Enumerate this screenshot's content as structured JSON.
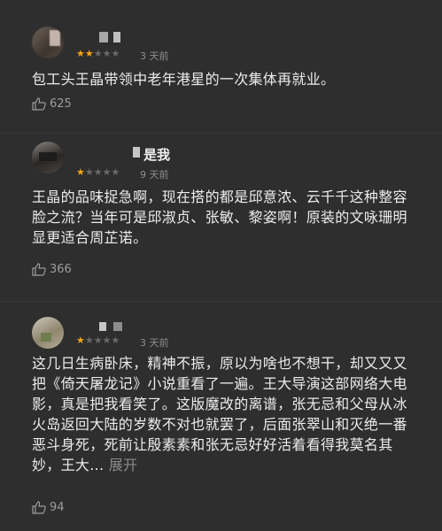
{
  "reviews": [
    {
      "name": "",
      "rating": 2,
      "stars": "★★★★★",
      "time": "3 天前",
      "text": "包工头王晶带领中老年港星的一次集体再就业。",
      "likes": "625",
      "avatar_icon": "user-avatar"
    },
    {
      "name": "是我",
      "rating": 1,
      "stars": "★★★★★",
      "time": "9 天前",
      "text": "王晶的品味捉急啊，现在搭的都是邱意浓、云千千这种整容脸之流？当年可是邱淑贞、张敏、黎姿啊！原装的文咏珊明显更适合周芷诺。",
      "likes": "366",
      "avatar_icon": "user-avatar"
    },
    {
      "name": "",
      "rating": 1,
      "stars": "★★★★★",
      "time": "3 天前",
      "text": "这几日生病卧床，精神不振，原以为啥也不想干，却又又又把《倚天屠龙记》小说重看了一遍。王大导演这部网络大电影，真是把我看笑了。这版魔改的离谱，张无忌和父母从冰火岛返回大陆的岁数不对也就罢了，后面张翠山和灭绝一番恶斗身死，死前让殷素素和张无忌好好活着看得我莫名其妙，王大...",
      "more": "展开",
      "likes": "94",
      "avatar_icon": "user-avatar"
    }
  ],
  "colors": {
    "background": "#2e2e2e",
    "star_on": "#f2a31b",
    "star_off": "#6a6a6a",
    "text": "#ececec",
    "meta": "#8e8e8e"
  }
}
